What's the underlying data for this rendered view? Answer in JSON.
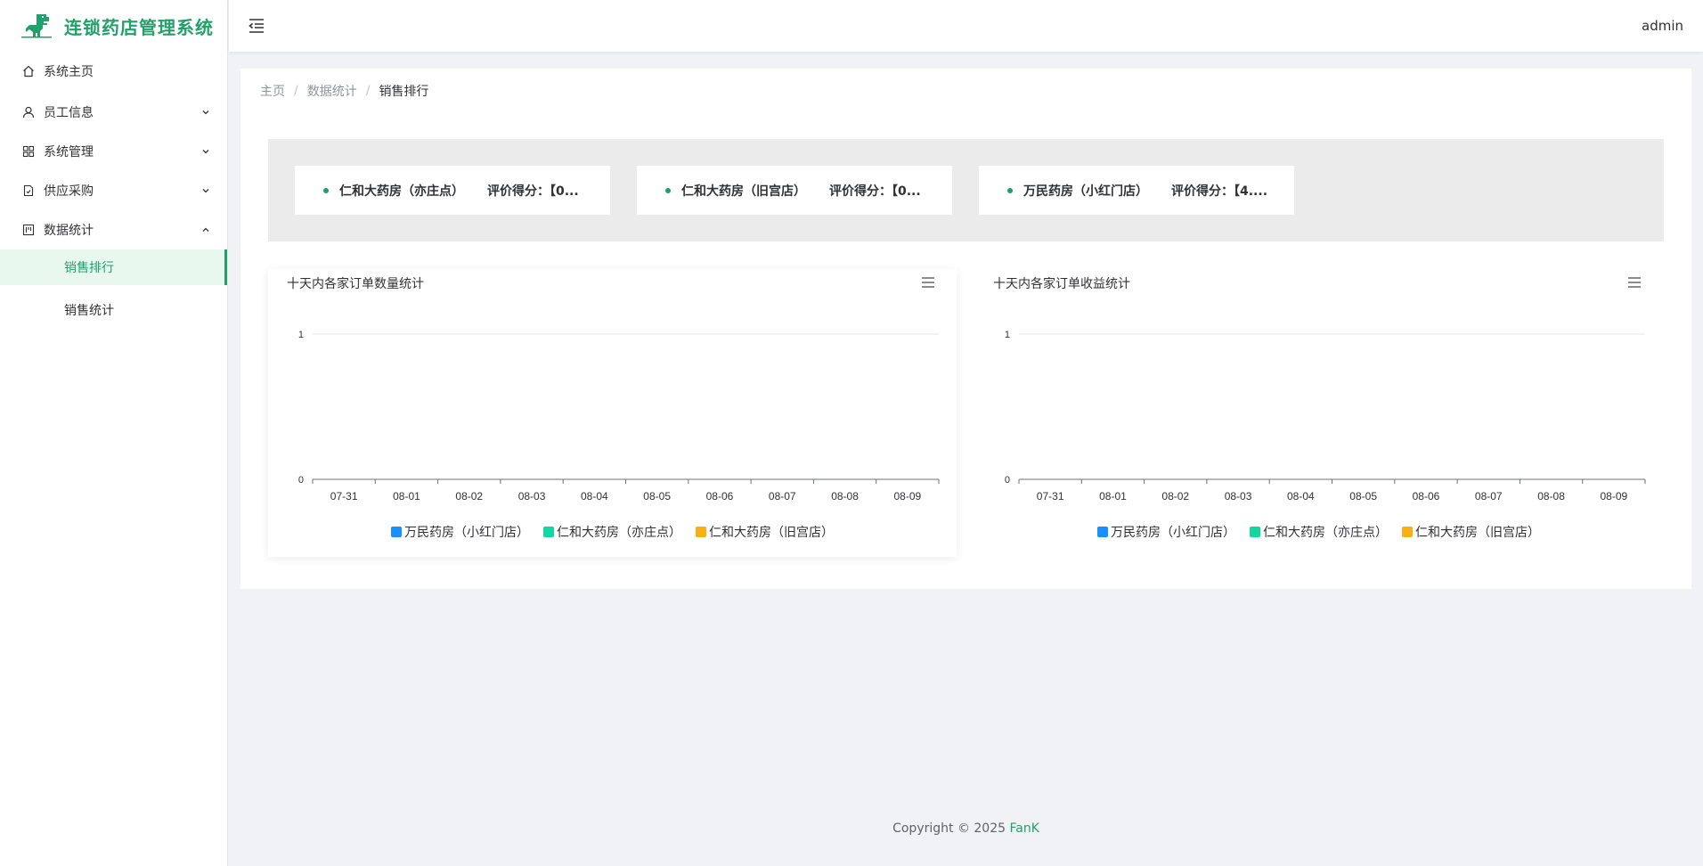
{
  "app": {
    "title": "连锁药店管理系统"
  },
  "header": {
    "user": "admin"
  },
  "sidebar": {
    "items": [
      {
        "label": "系统主页",
        "icon": "home-icon",
        "expandable": false
      },
      {
        "label": "员工信息",
        "icon": "user-icon",
        "expandable": true,
        "expanded": false
      },
      {
        "label": "系统管理",
        "icon": "grid-icon",
        "expandable": true,
        "expanded": false
      },
      {
        "label": "供应采购",
        "icon": "document-icon",
        "expandable": true,
        "expanded": false
      },
      {
        "label": "数据统计",
        "icon": "chart-icon",
        "expandable": true,
        "expanded": true
      }
    ],
    "subitems": [
      {
        "label": "销售排行",
        "active": true
      },
      {
        "label": "销售统计",
        "active": false
      }
    ]
  },
  "breadcrumb": [
    "主页",
    "数据统计",
    "销售排行"
  ],
  "ranking": [
    {
      "store": "仁和大药房（亦庄点）",
      "score": "评价得分：【0..."
    },
    {
      "store": "仁和大药房（旧宫店）",
      "score": "评价得分：【0..."
    },
    {
      "store": "万民药房（小红门店）",
      "score": "评价得分：【4...."
    }
  ],
  "colors": {
    "accent": "#22a06b",
    "series_1": "#1890ff",
    "series_2": "#13d6a0",
    "series_3": "#f7b017"
  },
  "chart_data": [
    {
      "type": "line",
      "title": "十天内各家订单数量统计",
      "categories": [
        "07-31",
        "08-01",
        "08-02",
        "08-03",
        "08-04",
        "08-05",
        "08-06",
        "08-07",
        "08-08",
        "08-09"
      ],
      "ylim": [
        0,
        1
      ],
      "yticks": [
        0,
        1
      ],
      "grid": true,
      "legend": "bottom",
      "series": [
        {
          "name": "万民药房（小红门店）",
          "values": []
        },
        {
          "name": "仁和大药房（亦庄点）",
          "values": []
        },
        {
          "name": "仁和大药房（旧宫店）",
          "values": []
        }
      ]
    },
    {
      "type": "line",
      "title": "十天内各家订单收益统计",
      "categories": [
        "07-31",
        "08-01",
        "08-02",
        "08-03",
        "08-04",
        "08-05",
        "08-06",
        "08-07",
        "08-08",
        "08-09"
      ],
      "ylim": [
        0,
        1
      ],
      "yticks": [
        0,
        1
      ],
      "grid": true,
      "legend": "bottom",
      "series": [
        {
          "name": "万民药房（小红门店）",
          "values": []
        },
        {
          "name": "仁和大药房（亦庄点）",
          "values": []
        },
        {
          "name": "仁和大药房（旧宫店）",
          "values": []
        }
      ]
    }
  ],
  "footer": {
    "copyright": "Copyright © 2025",
    "brand": "FanK"
  }
}
